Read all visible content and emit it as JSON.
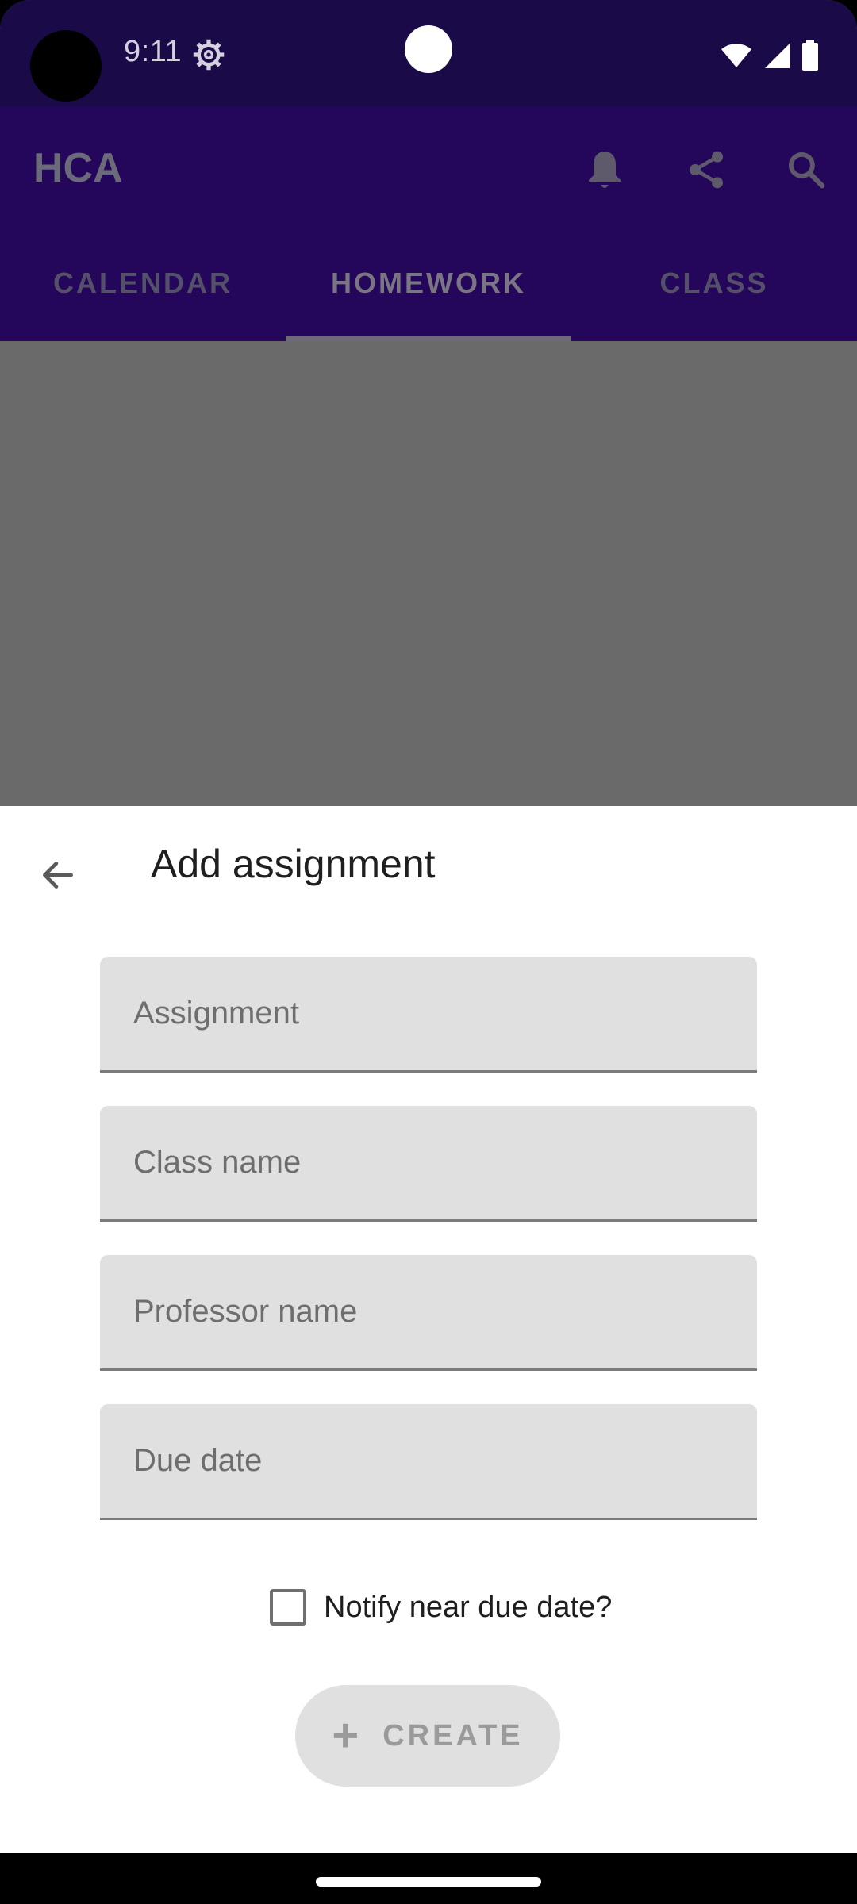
{
  "status_bar": {
    "time": "9:11",
    "icons": [
      "settings-gear-icon",
      "wifi-icon",
      "signal-icon",
      "battery-icon"
    ]
  },
  "app_bar": {
    "title": "HCA",
    "actions": [
      "bell-icon",
      "share-icon",
      "search-icon"
    ],
    "tabs": [
      {
        "label": "CALENDAR",
        "active": false
      },
      {
        "label": "HOMEWORK",
        "active": true
      },
      {
        "label": "CLASS",
        "active": false
      }
    ]
  },
  "sheet": {
    "title": "Add assignment",
    "fields": {
      "assignment": {
        "placeholder": "Assignment",
        "value": ""
      },
      "class_name": {
        "placeholder": "Class name",
        "value": ""
      },
      "professor_name": {
        "placeholder": "Professor name",
        "value": ""
      },
      "due_date": {
        "placeholder": "Due date",
        "value": ""
      }
    },
    "notify_label": "Notify near due date?",
    "notify_checked": false,
    "create_label": "CREATE"
  },
  "colors": {
    "status_bar": "#1b0a48",
    "app_bar": "#24065a",
    "scrim": "#6a6a6a",
    "field_bg": "#e0e0e0"
  }
}
